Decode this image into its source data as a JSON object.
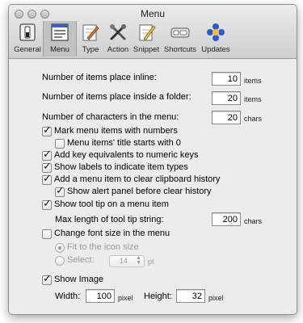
{
  "window": {
    "title": "Menu"
  },
  "toolbar": [
    {
      "label": "General",
      "icon": "general-switch-icon"
    },
    {
      "label": "Menu",
      "icon": "menu-list-icon"
    },
    {
      "label": "Type",
      "icon": "type-pen-icon"
    },
    {
      "label": "Action",
      "icon": "action-tools-icon"
    },
    {
      "label": "Snippet",
      "icon": "snippet-pencil-icon"
    },
    {
      "label": "Shortcuts",
      "icon": "shortcuts-keyboard-icon"
    },
    {
      "label": "Updates",
      "icon": "updates-dots-icon"
    }
  ],
  "selected_tab": "Menu",
  "settings": {
    "inline": {
      "label": "Number of items place inline:",
      "value": "10",
      "unit": "items"
    },
    "folder": {
      "label": "Number of items place inside a folder:",
      "value": "20",
      "unit": "items"
    },
    "chars": {
      "label": "Number of characters in the menu:",
      "value": "20",
      "unit": "chars"
    },
    "mark_numbers": {
      "label": "Mark menu items with numbers",
      "checked": true
    },
    "title_zero": {
      "label": "Menu items' title starts with 0",
      "checked": false
    },
    "key_equiv": {
      "label": "Add key equivalents to numeric keys",
      "checked": true
    },
    "show_labels": {
      "label": "Show labels to indicate item types",
      "checked": true
    },
    "clear_history": {
      "label": "Add a menu item to clear clipboard history",
      "checked": true
    },
    "alert_panel": {
      "label": "Show alert panel before clear history",
      "checked": true
    },
    "tooltip": {
      "label": "Show tool tip on a menu item",
      "checked": true
    },
    "tooltip_len": {
      "label": "Max length of tool tip string:",
      "value": "200",
      "unit": "chars"
    },
    "font_size": {
      "label": "Change font size in the menu",
      "checked": false
    },
    "fit_icon": {
      "label": "Fit to the icon size",
      "selected": true
    },
    "select": {
      "label": "Select:",
      "value": "14",
      "unit": "pt"
    },
    "show_image": {
      "label": "Show Image",
      "checked": true
    },
    "width": {
      "label": "Width:",
      "value": "100",
      "unit": "pixel"
    },
    "height": {
      "label": "Height:",
      "value": "32",
      "unit": "pixel"
    }
  }
}
